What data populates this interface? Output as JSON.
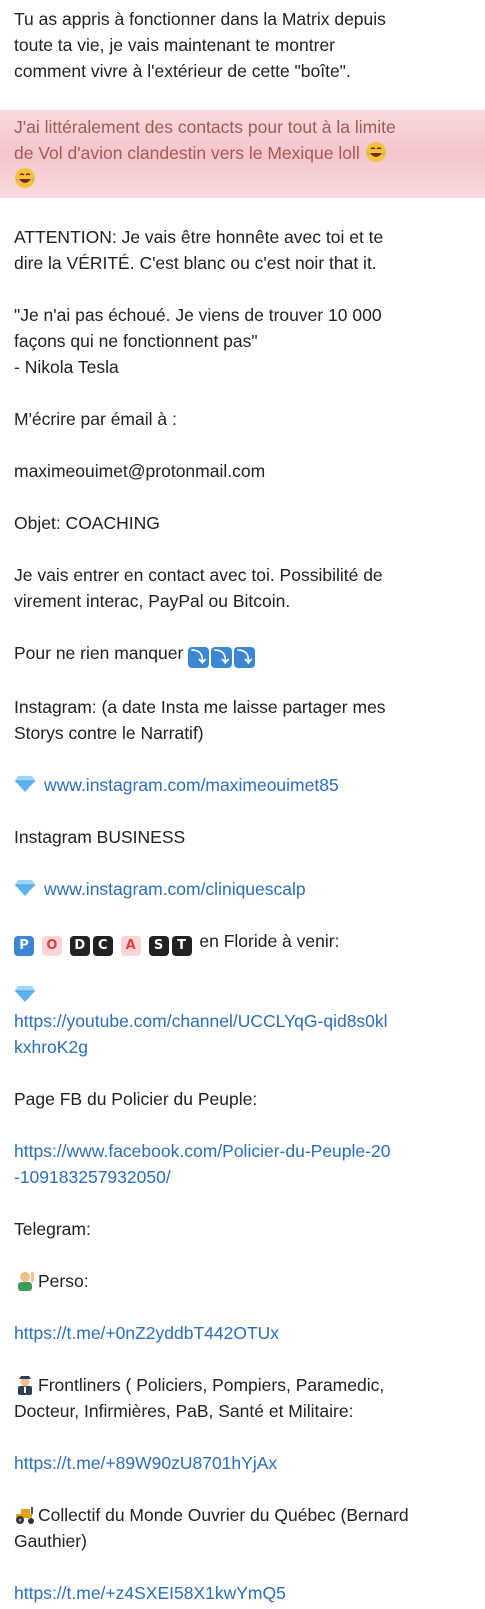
{
  "message": {
    "intro_1": "Tu as appris à fonctionner dans la Matrix depuis",
    "intro_2": "toute ta vie, je vais maintenant te montrer",
    "intro_3": "comment vivre à l'extérieur de cette \"boîte\".",
    "highlight_1": "J'ai littéralement des contacts pour tout à la limite",
    "highlight_2": "de Vol d'avion clandestin vers le Mexique loll",
    "attention_1": "ATTENTION: Je vais être honnête avec toi et te",
    "attention_2": "dire la VÉRITÉ. C'est blanc ou c'est noir that it.",
    "quote_1": "\"Je n'ai pas échoué. Je viens de trouver 10 000",
    "quote_2": "façons qui ne fonctionnent pas\"",
    "quote_author": "- Nikola Tesla",
    "email_prompt": "M'écrire par émail à :",
    "email": "maximeouimet@protonmail.com",
    "subject": "Objet: COACHING",
    "contact_1": "Je vais entrer en contact avec toi. Possibilité de",
    "contact_2": "virement interac, PayPal ou Bitcoin.",
    "follow": "Pour ne rien manquer",
    "instagram_1": "Instagram: (a date Insta me laisse partager mes",
    "instagram_2": "Storys contre le Narratif)",
    "instagram_link": "www.instagram.com/maximeouimet85",
    "instagram_business": "Instagram BUSINESS",
    "instagram_business_link": "www.instagram.com/cliniquescalp",
    "podcast_letters": [
      "P",
      "O",
      "D",
      "C",
      "A",
      "S",
      "T"
    ],
    "podcast_text": "en Floride à venir:",
    "youtube_link_1": "https://youtube.com/channel/UCCLYqG-qid8s0kl",
    "youtube_link_2": "kxhroK2g",
    "fb_title": "Page FB du Policier du Peuple:",
    "fb_link_1": "https://www.facebook.com/Policier-du-Peuple-20",
    "fb_link_2": "-109183257932050/",
    "telegram": "Telegram:",
    "perso": "Perso:",
    "perso_link": "https://t.me/+0nZ2yddbT442OTUx",
    "frontliners_1": "Frontliners ( Policiers, Pompiers, Paramedic,",
    "frontliners_2": "Docteur, Infirmières, PaB, Santé et Militaire:",
    "frontliners_link": "https://t.me/+89W90zU8701hYjAx",
    "collectif_1": "Collectif du Monde Ouvrier du Québec (Bernard",
    "collectif_2": "Gauthier)",
    "collectif_link": "https://t.me/+z4SXEI58X1kwYmQ5"
  },
  "icons": {
    "laugh": "face-with-tears-of-joy-icon",
    "diamond": "blue-diamond-icon",
    "arrow": "down-arrow-button-icon",
    "perso": "person-raising-hand-icon",
    "frontliners": "officer-icon",
    "collectif": "tractor-icon"
  },
  "colors": {
    "link": "#2a6ebd",
    "highlight": "#ed96a0",
    "highlight_text": "#a55a53"
  }
}
